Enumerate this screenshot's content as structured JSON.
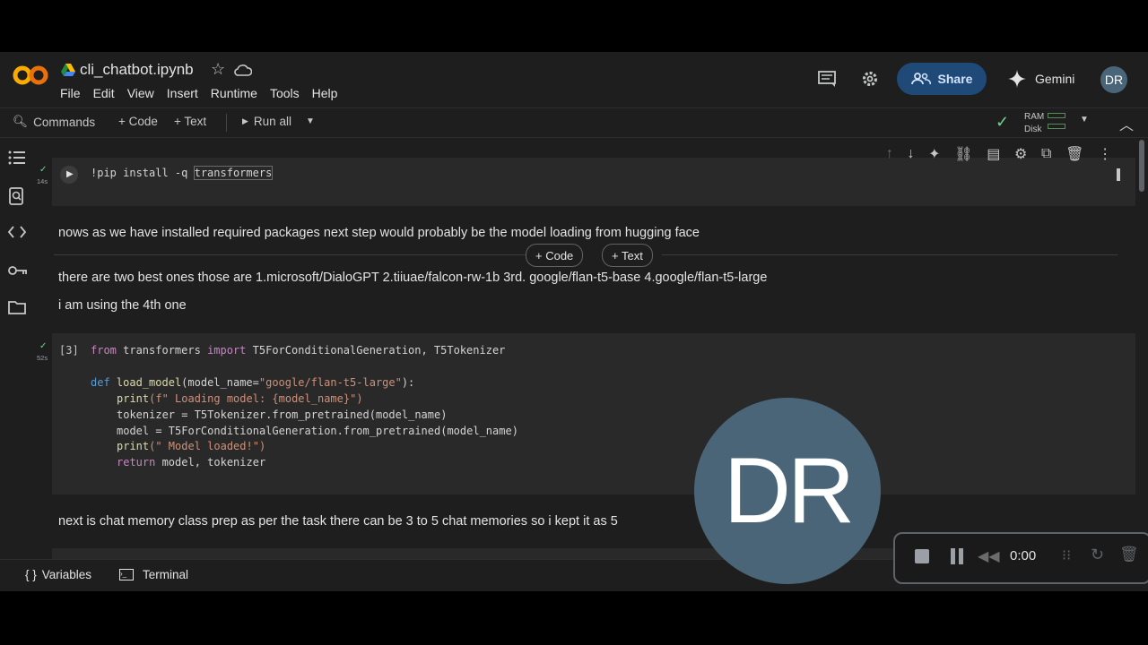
{
  "header": {
    "title": "cli_chatbot.ipynb",
    "menu": [
      "File",
      "Edit",
      "View",
      "Insert",
      "Runtime",
      "Tools",
      "Help"
    ],
    "share_label": "Share",
    "gemini_label": "Gemini",
    "avatar_initials": "DR"
  },
  "toolbar": {
    "commands": "Commands",
    "code": "+ Code",
    "text": "+ Text",
    "run_all": "Run all",
    "ram": "RAM",
    "disk": "Disk"
  },
  "cells": {
    "c1": {
      "time": "14s",
      "code_prefix": "!pip install -q ",
      "code_highlight": "transformers"
    },
    "md1": "nows as we have installed required packages next step would probably be the model loading from hugging face",
    "insert_code": "+ Code",
    "insert_text": "+ Text",
    "md2": "there are two best ones those are 1.microsoft/DialoGPT 2.tiiuae/falcon-rw-1b 3rd. google/flan-t5-base 4.google/flan-t5-large",
    "md3": "i am using the 4th one",
    "c3": {
      "exec_count": "[3]",
      "time": "52s",
      "lines": [
        {
          "t": "from",
          "c": "kw"
        },
        {
          "t": " transformers ",
          "c": ""
        },
        {
          "t": "import",
          "c": "kw"
        },
        {
          "t": " T5ForConditionalGeneration, T5Tokenizer",
          "c": ""
        }
      ],
      "l3_def": "def",
      "l3_fn": "load_model",
      "l3_arg": "(model_name=",
      "l3_str": "\"google/flan-t5-large\"",
      "l3_end": "):",
      "l4_fn": "print",
      "l4_str": "(f\" Loading model: {model_name}\")",
      "l5": "tokenizer = T5Tokenizer.from_pretrained(model_name)",
      "l6": "model = T5ForConditionalGeneration.from_pretrained(model_name)",
      "l7_fn": "print",
      "l7_str": "(\" Model loaded!\")",
      "l8_kw": "return",
      "l8": " model, tokenizer"
    },
    "md4": "next is chat memory class prep as per the task there can be 3 to 5 chat memories so i kept it as 5"
  },
  "bottom": {
    "variables": "Variables",
    "terminal": "Terminal"
  },
  "overlay": {
    "avatar_initials": "DR",
    "recorder_time": "0:00"
  },
  "colors": {
    "accent_share": "#1f4a78",
    "avatar": "#4a6578",
    "cell_bg": "#292929",
    "check": "#6dd58c"
  }
}
